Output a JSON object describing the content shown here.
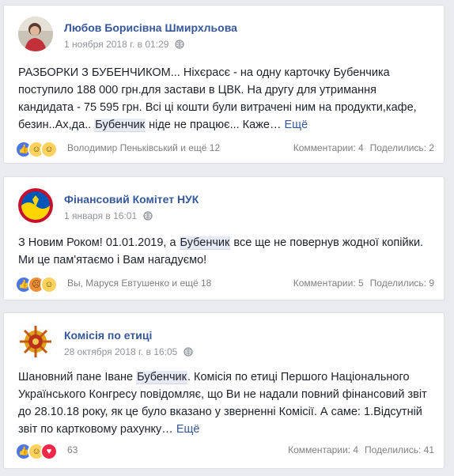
{
  "posts": [
    {
      "author": "Любов Борисівна Шмирхльова",
      "date": "1 ноября 2018 г. в 01:29",
      "text_before": "РАЗБОРКИ З БУБЕНЧИКОМ... Ніхєрасє - на одну карточку Бубенчика поступило 188 000 грн.для застави в ЦВК. На другу для утримання кандидата - 75 595 грн. Всі ці кошти були витрачені ним на продукти,кафе, безин..Ах,да.. ",
      "highlight": "Бубенчик",
      "text_after": " ніде не працює... Каже… ",
      "more": "Ещё",
      "reactions_text": "Володимир Пеньківський и ещё 12",
      "comments": "Комментарии: 4",
      "shares": "Поделились: 2",
      "reaction_icons": [
        "like-icon",
        "wow-icon",
        "haha-icon"
      ]
    },
    {
      "author": "Фінансовий Комітет НУК",
      "date": "1 января в 16:01",
      "text_before": "З Новим Роком! 01.01.2019, а ",
      "highlight": "Бубенчик",
      "text_after": " все ще не повернув жодної копійки. Ми це пам'ятаємо і Вам нагадуємо!",
      "more": "",
      "reactions_text": "Вы, Маруся Евтушенко и ещё 18",
      "comments": "Комментарии: 5",
      "shares": "Поделились: 9",
      "reaction_icons": [
        "like-icon",
        "angry-icon",
        "wow-icon"
      ]
    },
    {
      "author": "Комісія по етиці",
      "date": "28 октября 2018 г. в 16:05",
      "text_before": "Шановний пане Іване ",
      "highlight": "Бубенчик",
      "text_after": ". Комісія по етиці Першого Національного Українського Конгресу повідомляє, що Ви не надали повний фінансовий звіт до 28.10.18 року, як це було вказано у зверненні Комісії. А саме: 1.Відсутній звіт по картковому рахунку… ",
      "more": "Ещё",
      "reactions_text": "63",
      "comments": "Комментарии: 4",
      "shares": "Поделились: 41",
      "reaction_icons": [
        "like-icon",
        "wow-icon",
        "love-icon"
      ]
    }
  ]
}
